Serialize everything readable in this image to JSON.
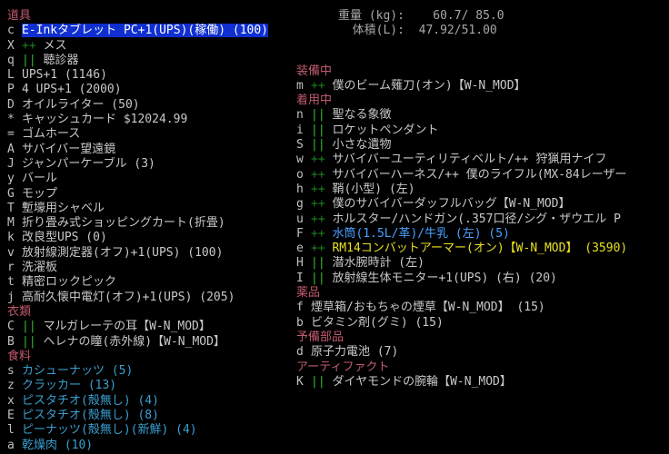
{
  "left": {
    "sections": [
      {
        "header": "道具",
        "items": [
          {
            "key": "c",
            "mark": "",
            "text": "E-Inkタブレット PC+1(UPS)(稼働) (100)",
            "selected": true
          },
          {
            "key": "X",
            "mark": "++",
            "text": "メス"
          },
          {
            "key": "q",
            "mark": "||",
            "text": "聴診器"
          },
          {
            "key": "L",
            "mark": "",
            "text": "UPS+1 (1146)"
          },
          {
            "key": "P",
            "mark": "",
            "text": "4 UPS+1 (2000)"
          },
          {
            "key": "D",
            "mark": "",
            "text": "オイルライター (50)"
          },
          {
            "key": "*",
            "mark": "",
            "text": "キャッシュカード $12024.99"
          },
          {
            "key": "=",
            "mark": "",
            "text": "ゴムホース"
          },
          {
            "key": "A",
            "mark": "",
            "text": "サバイバー望遠鏡"
          },
          {
            "key": "J",
            "mark": "",
            "text": "ジャンパーケーブル (3)"
          },
          {
            "key": "y",
            "mark": "",
            "text": "バール"
          },
          {
            "key": "G",
            "mark": "",
            "text": "モップ"
          },
          {
            "key": "T",
            "mark": "",
            "text": "塹壕用シャベル"
          },
          {
            "key": "M",
            "mark": "",
            "text": "折り畳み式ショッピングカート(折畳)"
          },
          {
            "key": "k",
            "mark": "",
            "text": "改良型UPS (0)"
          },
          {
            "key": "v",
            "mark": "",
            "text": "放射線測定器(オフ)+1(UPS) (100)"
          },
          {
            "key": "r",
            "mark": "",
            "text": "洗濯板"
          },
          {
            "key": "t",
            "mark": "",
            "text": "精密ロックピック"
          },
          {
            "key": "j",
            "mark": "",
            "text": "高耐久懐中電灯(オフ)+1(UPS) (205)"
          }
        ]
      },
      {
        "header": "衣類",
        "items": [
          {
            "key": "C",
            "mark": "||",
            "text": "マルガレーテの耳【W-N_MOD】"
          },
          {
            "key": "B",
            "mark": "||",
            "text": "ヘレナの瞳(赤外線)【W-N_MOD】"
          }
        ]
      },
      {
        "header": "食料",
        "items": [
          {
            "key": "s",
            "mark": "",
            "text": "カシューナッツ (5)",
            "color": "cyan"
          },
          {
            "key": "z",
            "mark": "",
            "text": "クラッカー (13)",
            "color": "cyan"
          },
          {
            "key": "x",
            "mark": "",
            "text": "ピスタチオ(殻無し) (4)",
            "color": "cyan"
          },
          {
            "key": "E",
            "mark": "",
            "text": "ピスタチオ(殻無し) (8)",
            "color": "cyan"
          },
          {
            "key": "l",
            "mark": "",
            "text": "ピーナッツ(殻無し)(新鮮) (4)",
            "color": "cyan"
          },
          {
            "key": "a",
            "mark": "",
            "text": "乾燥肉 (10)",
            "color": "cyan"
          }
        ]
      }
    ]
  },
  "right": {
    "weight_label": "重量 (kg):",
    "weight_value": "60.7/ 85.0",
    "volume_label": "体積(L):",
    "volume_value": "47.92/51.00",
    "sections": [
      {
        "header": "装備中",
        "items": [
          {
            "key": "m",
            "mark": "++",
            "text": "僕のビーム薙刀(オン)【W-N_MOD】"
          }
        ]
      },
      {
        "header": "着用中",
        "items": [
          {
            "key": "n",
            "mark": "||",
            "text": "聖なる象徴"
          },
          {
            "key": "i",
            "mark": "||",
            "text": "ロケットペンダント"
          },
          {
            "key": "S",
            "mark": "||",
            "text": "小さな遺物"
          },
          {
            "key": "w",
            "mark": "++",
            "text": "サバイバーユーティリティベルト/++ 狩猟用ナイフ"
          },
          {
            "key": "o",
            "mark": "++",
            "text": "サバイバーハーネス/++ 僕のライフル(MX-84レーザー"
          },
          {
            "key": "h",
            "mark": "++",
            "text": "鞘(小型) (左)"
          },
          {
            "key": "g",
            "mark": "++",
            "text": "僕のサバイバーダッフルバッグ【W-N_MOD】"
          },
          {
            "key": "u",
            "mark": "++",
            "text": "ホルスター/ハンドガン(.357口径/シグ・ザウエル P"
          },
          {
            "key": "F",
            "mark": "++",
            "text": "水筒(1.5L/革)/牛乳 (左) (5)",
            "color": "blue"
          },
          {
            "key": "e",
            "mark": "++",
            "text": "RM14コンバットアーマー(オン)【W-N_MOD】 (3590)",
            "color": "yellow"
          },
          {
            "key": "H",
            "mark": "||",
            "text": "潜水腕時計 (左)"
          },
          {
            "key": "I",
            "mark": "||",
            "text": "放射線生体モニター+1(UPS) (右) (20)"
          }
        ]
      },
      {
        "header": "薬品",
        "items": [
          {
            "key": "f",
            "mark": "",
            "text": "煙草箱/おもちゃの煙草【W-N_MOD】 (15)"
          },
          {
            "key": "b",
            "mark": "",
            "text": "ビタミン剤(グミ) (15)"
          }
        ]
      },
      {
        "header": "予備部品",
        "items": [
          {
            "key": "d",
            "mark": "",
            "text": "原子力電池 (7)"
          }
        ]
      },
      {
        "header": "アーティファクト",
        "items": [
          {
            "key": "K",
            "mark": "||",
            "text": "ダイヤモンドの腕輪【W-N_MOD】"
          }
        ]
      }
    ]
  }
}
